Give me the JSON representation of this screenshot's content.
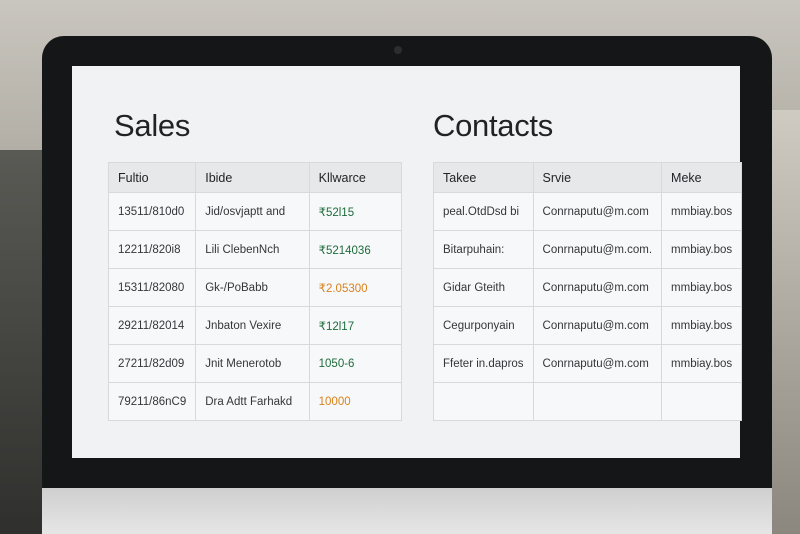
{
  "sales": {
    "title": "Sales",
    "headers": [
      "Fultio",
      "Ibide",
      "Kllwarce"
    ],
    "rows": [
      [
        "13511/810d0",
        "Jid/osvjaptt and",
        "₹52l15"
      ],
      [
        "12211/820i8",
        "Lili ClebenNch",
        "₹5214036"
      ],
      [
        "15311/82080",
        "Gk-/PoBabb",
        "₹2.05300"
      ],
      [
        "29211/82014",
        "Jnbaton Vexire",
        "₹12l17"
      ],
      [
        "27211/82d09",
        "Jnit Menerotob",
        "1050-6"
      ],
      [
        "79211/86nC9",
        "Dra Adtt Farhakd",
        "10000"
      ]
    ],
    "amount_status": [
      "green",
      "green",
      "orange",
      "green",
      "green",
      "orange"
    ]
  },
  "contacts": {
    "title": "Contacts",
    "headers": [
      "Takee",
      "Srvie",
      "Meke"
    ],
    "rows": [
      [
        "peal.OtdDsd bi",
        "Conrnaputu@m.com",
        "mmbiay.bos"
      ],
      [
        "Bitarpuhain:",
        "Conrnaputu@m.com.",
        "mmbiay.bos"
      ],
      [
        "Gidar Gteith",
        "Conrnaputu@m.com",
        "mmbiay.bos"
      ],
      [
        "Cegurponyain",
        "Conrnaputu@m.com",
        "mmbiay.bos"
      ],
      [
        "Ffeter in.dapros",
        "Conrnaputu@m.com",
        "mmbiay.bos"
      ],
      [
        "",
        "",
        ""
      ]
    ]
  }
}
